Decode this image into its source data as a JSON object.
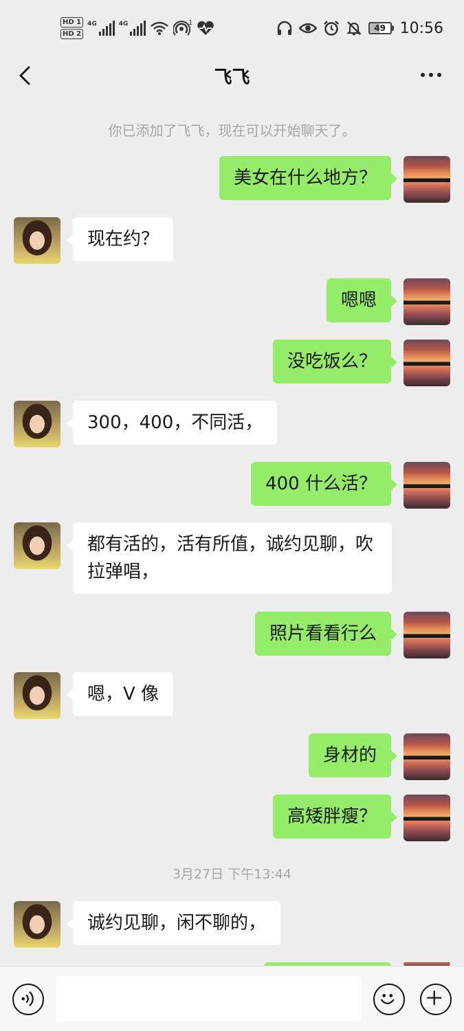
{
  "status_bar": {
    "hd1": "HD 1",
    "hd2": "HD 2",
    "net1": "4G",
    "net2": "4G",
    "hotspot_count": "1",
    "battery": "49",
    "time": "10:56"
  },
  "header": {
    "title": "飞飞"
  },
  "chat": {
    "system_notice": "你已添加了飞飞，现在可以开始聊天了。",
    "timestamp": "3月27日 下午13:44",
    "messages": [
      {
        "from": "me",
        "text": "美女在什么地方？"
      },
      {
        "from": "them",
        "text": "现在约？"
      },
      {
        "from": "me",
        "text": "嗯嗯"
      },
      {
        "from": "me",
        "text": "没吃饭么？"
      },
      {
        "from": "them",
        "text": "300，400，不同活，"
      },
      {
        "from": "me",
        "text": "400 什么活？"
      },
      {
        "from": "them",
        "text": "都有活的，活有所值，诚约见聊，吹拉弹唱，"
      },
      {
        "from": "me",
        "text": "照片看看行么"
      },
      {
        "from": "them",
        "text": "嗯，V 像"
      },
      {
        "from": "me",
        "text": "身材的"
      },
      {
        "from": "me",
        "text": "高矮胖瘦？"
      },
      {
        "from": "them",
        "text": "诚约见聊，闲不聊的，"
      }
    ]
  },
  "input": {
    "placeholder": "",
    "value": ""
  },
  "colors": {
    "background": "#ededed",
    "my_bubble": "#95ec69",
    "their_bubble": "#ffffff",
    "system_text": "#a6a6a6"
  }
}
